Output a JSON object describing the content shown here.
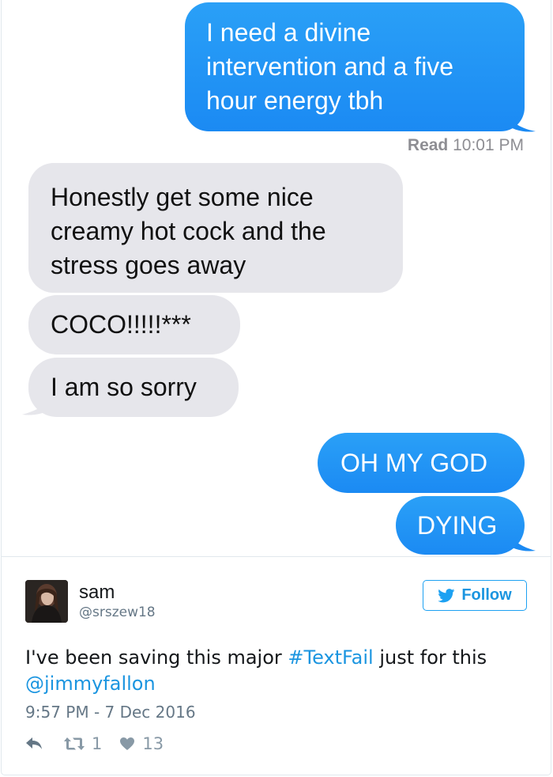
{
  "conversation": {
    "messages": [
      {
        "direction": "outgoing",
        "lines": [
          "I need a divine",
          "intervention and a five",
          "hour energy tbh"
        ]
      },
      {
        "direction": "incoming",
        "lines": [
          "Honestly get some nice",
          "creamy hot cock and the",
          "stress goes away"
        ]
      },
      {
        "direction": "incoming",
        "lines": [
          "COCO!!!!!***"
        ]
      },
      {
        "direction": "incoming",
        "lines": [
          "I am so sorry"
        ]
      },
      {
        "direction": "outgoing",
        "lines": [
          "OH MY GOD"
        ]
      },
      {
        "direction": "outgoing",
        "lines": [
          "DYING"
        ]
      }
    ],
    "read_receipt": {
      "label": "Read",
      "time": "10:01 PM"
    }
  },
  "tweet": {
    "author_name": "sam",
    "author_handle": "@srszew18",
    "follow_label": "Follow",
    "text_before": "I've been saving this major ",
    "hashtag": "#TextFail",
    "text_middle": " just for this ",
    "mention": "@jimmyfallon",
    "timestamp": "9:57 PM - 7 Dec 2016",
    "retweet_count": "1",
    "like_count": "13"
  },
  "colors": {
    "imessage_blue": "#1f8ff5",
    "incoming_gray": "#e6e6eb",
    "twitter_blue": "#1da1f2",
    "muted_text": "#657786"
  }
}
